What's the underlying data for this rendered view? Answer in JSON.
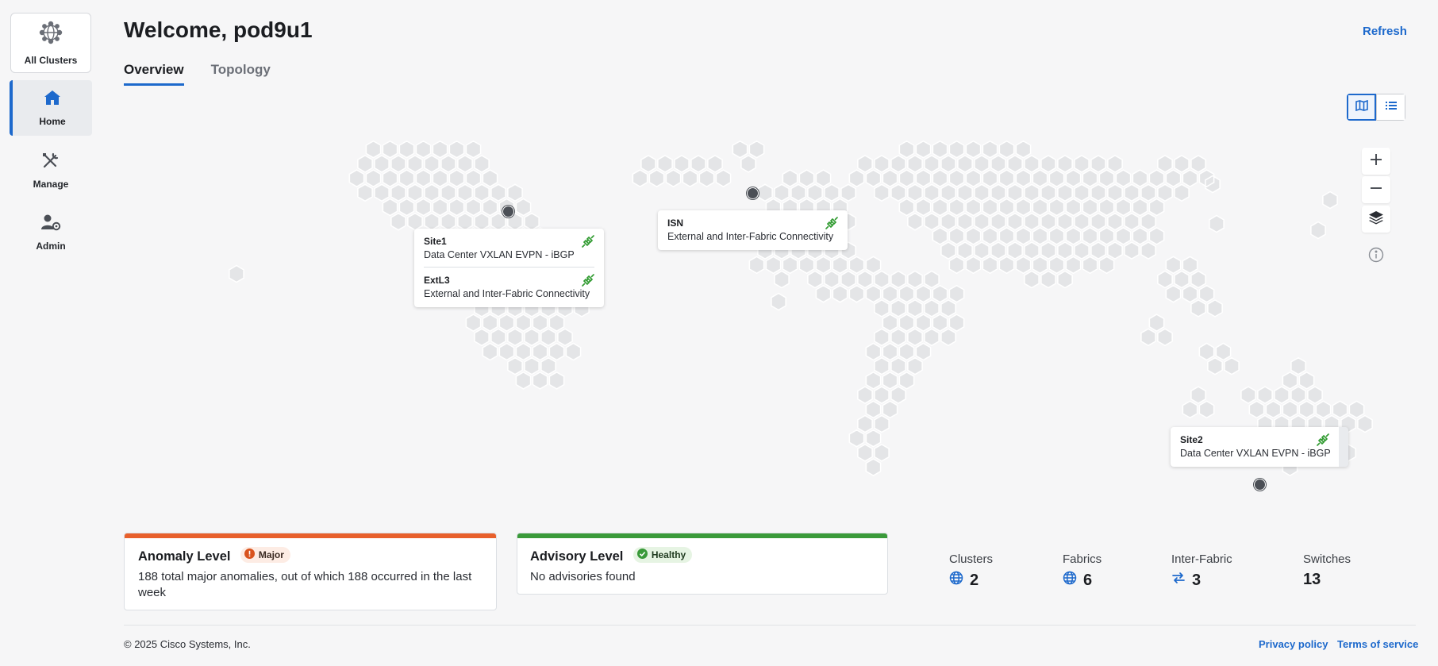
{
  "sidebar": {
    "all_clusters": "All Clusters",
    "items": [
      {
        "label": "Home",
        "icon": "home-icon",
        "active": true
      },
      {
        "label": "Manage",
        "icon": "tools-icon"
      },
      {
        "label": "Admin",
        "icon": "user-gear-icon"
      }
    ]
  },
  "header": {
    "title": "Welcome, pod9u1",
    "refresh_label": "Refresh"
  },
  "tabs": [
    {
      "label": "Overview",
      "active": true
    },
    {
      "label": "Topology"
    }
  ],
  "map": {
    "callouts": [
      {
        "entries": [
          {
            "name": "Site1",
            "desc": "Data Center VXLAN EVPN - iBGP"
          },
          {
            "name": "ExtL3",
            "desc": "External and Inter-Fabric Connectivity"
          }
        ]
      },
      {
        "entries": [
          {
            "name": "ISN",
            "desc": "External and Inter-Fabric Connectivity"
          }
        ]
      },
      {
        "entries": [
          {
            "name": "Site2",
            "desc": "Data Center VXLAN EVPN - iBGP"
          }
        ]
      }
    ]
  },
  "anomaly": {
    "title": "Anomaly Level",
    "badge": "Major",
    "text": "188 total major anomalies, out of which 188 occurred in the last week",
    "color": "#e8602c"
  },
  "advisory": {
    "title": "Advisory Level",
    "badge": "Healthy",
    "text": "No advisories found",
    "color": "#3a9a3a"
  },
  "stats": [
    {
      "label": "Clusters",
      "value": "2",
      "icon": "globe-icon"
    },
    {
      "label": "Fabrics",
      "value": "6",
      "icon": "globe-icon"
    },
    {
      "label": "Inter-Fabric",
      "value": "3",
      "icon": "swap-icon"
    },
    {
      "label": "Switches",
      "value": "13"
    }
  ],
  "footer": {
    "copyright": "© 2025 Cisco Systems, Inc.",
    "privacy": "Privacy policy",
    "terms": "Terms of service"
  },
  "colors": {
    "accent": "#1d69cc",
    "link_green": "#2f9a2f"
  }
}
